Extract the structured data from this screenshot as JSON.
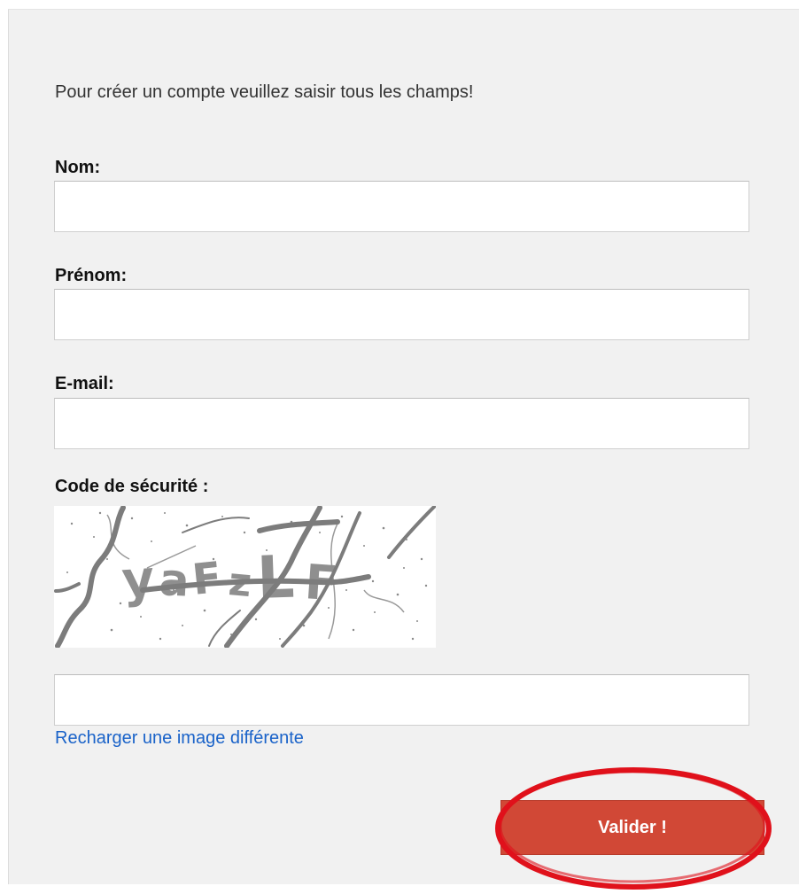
{
  "form": {
    "intro_text": "Pour créer un compte veuillez saisir tous les champs!",
    "fields": {
      "nom_label": "Nom:",
      "nom_value": "",
      "prenom_label": "Prénom:",
      "prenom_value": "",
      "email_label": "E-mail:",
      "email_value": "",
      "code_label": "Code de sécurité :",
      "code_value": ""
    },
    "captcha_text": "yaFzLF",
    "reload_link_text": "Recharger une image différente",
    "submit_label": "Valider !"
  },
  "colors": {
    "panel_background": "#f1f1f1",
    "submit_background": "#d14836",
    "link": "#1a63c9",
    "highlight_ring": "#e0111b"
  },
  "icons": {
    "captcha": "captcha-image",
    "annotation": "red-ellipse-highlight"
  }
}
